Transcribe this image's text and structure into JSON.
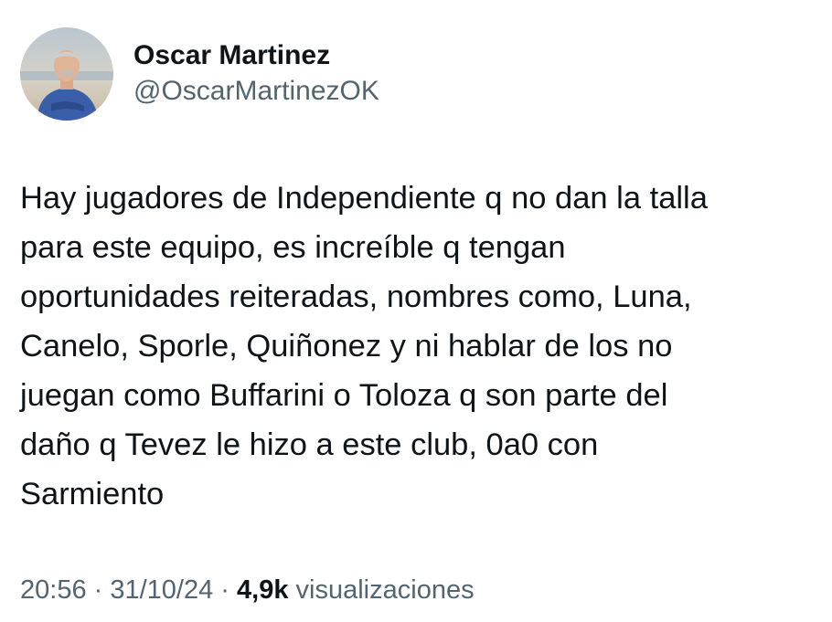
{
  "author": {
    "display_name": "Oscar Martinez",
    "handle": "@OscarMartinezOK",
    "avatar_icon": "profile-photo"
  },
  "tweet": {
    "text": "Hay jugadores de Independiente q no dan la talla\npara este equipo, es increíble q tengan\noportunidades reiteradas, nombres como, Luna,\nCanelo, Sporle, Quiñonez y ni hablar de los no\njuegan como Buffarini o Toloza q son parte del\ndaño q Tevez le hizo a este club, 0a0 con\nSarmiento"
  },
  "meta": {
    "time": "20:56",
    "separator": " · ",
    "date": "31/10/24",
    "views_count": "4,9k",
    "views_label": " visualizaciones"
  },
  "colors": {
    "text": "#0f1419",
    "secondary": "#536471",
    "background": "#ffffff"
  }
}
